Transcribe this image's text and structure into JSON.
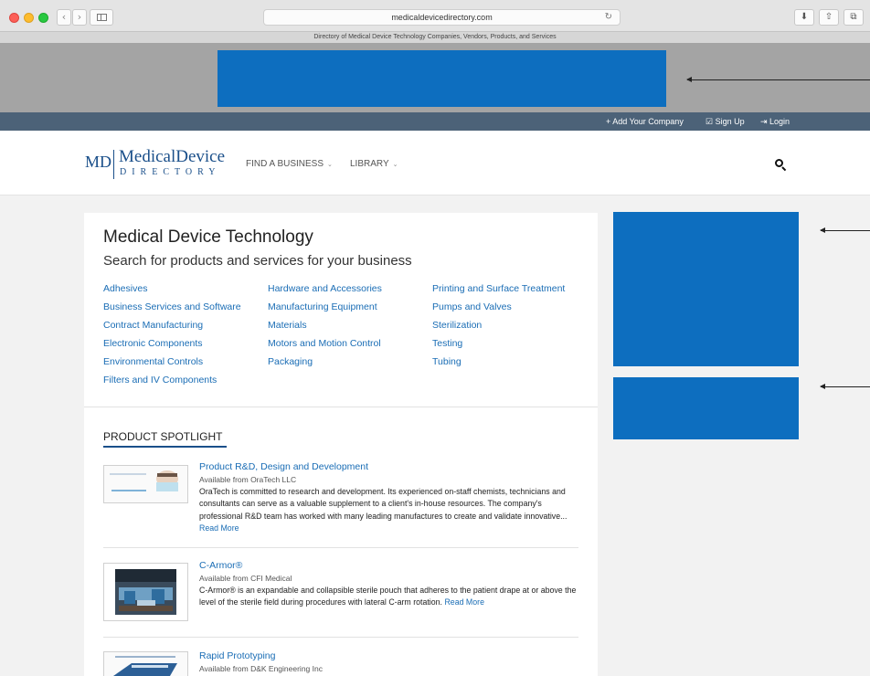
{
  "browser": {
    "url": "medicaldevicedirectory.com",
    "tab_title": "Directory of Medical Device Technology Companies, Vendors, Products, and Services",
    "back": "‹",
    "forward": "›",
    "reload": "↻",
    "download": "⬇",
    "share": "⇧",
    "tabs": "⧉"
  },
  "userbar": {
    "add_company": "+ Add Your Company",
    "sign_up": "☑ Sign Up",
    "login": "⇥ Login"
  },
  "header": {
    "logo_md": "MD",
    "logo_main": "MedicalDevice",
    "logo_sub": "DIRECTORY",
    "nav": [
      {
        "label": "FIND A BUSINESS",
        "caret": "⌄"
      },
      {
        "label": "LIBRARY",
        "caret": "⌄"
      }
    ]
  },
  "main": {
    "title": "Medical Device Technology",
    "subtitle": "Search for products and services for your business",
    "categories": {
      "col1": [
        "Adhesives",
        "Business Services and Software",
        "Contract Manufacturing",
        "Electronic Components",
        "Environmental Controls",
        "Filters and IV Components"
      ],
      "col2": [
        "Hardware and Accessories",
        "Manufacturing Equipment",
        "Materials",
        "Motors and Motion Control",
        "Packaging"
      ],
      "col3": [
        "Printing and Surface Treatment",
        "Pumps and Valves",
        "Sterilization",
        "Testing",
        "Tubing"
      ]
    },
    "spotlight_title": "PRODUCT SPOTLIGHT",
    "items": [
      {
        "title": "Product R&D, Design and Development",
        "from": "Available from OraTech LLC",
        "desc": "OraTech is committed to research and development. Its experienced on-staff chemists, technicians and consultants can serve as a valuable supplement to a client's in-house resources. The company's professional R&D team has worked with many leading manufactures to create and validate innovative...",
        "more": "Read More"
      },
      {
        "title": "C-Armor®",
        "from": "Available from CFI Medical",
        "desc": "C-Armor® is an expandable and collapsible sterile pouch that adheres to the patient drape at or above the level of the sterile field during procedures with lateral C-arm rotation.",
        "more": "Read More"
      },
      {
        "title": "Rapid Prototyping",
        "from": "Available from D&K Engineering Inc"
      }
    ]
  },
  "colors": {
    "ad_blue": "#0d6ebf",
    "link_blue": "#1a6db5",
    "userbar": "#4c6278"
  }
}
